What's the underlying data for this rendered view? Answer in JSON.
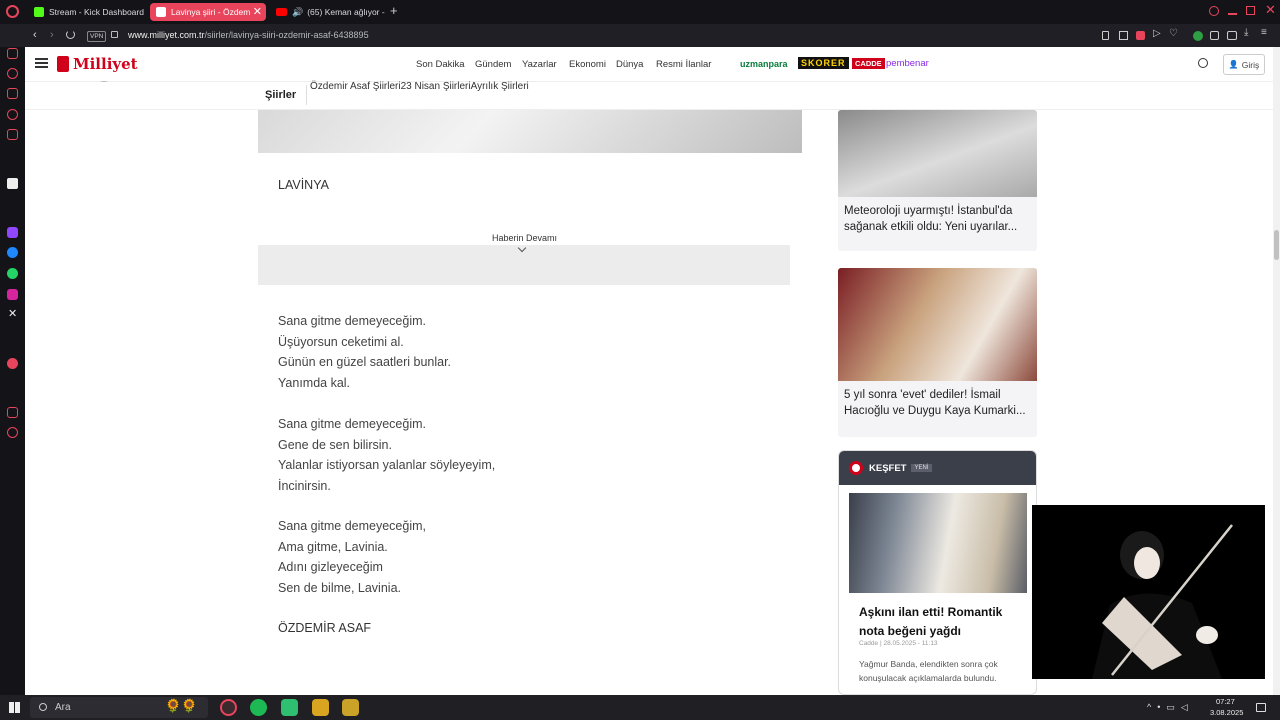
{
  "tabs": [
    {
      "label": "Stream - Kick Dashboard",
      "icon": "kick-icon"
    },
    {
      "label": "Lavinya şiiri - Özdem",
      "icon": "milliyet-favicon"
    },
    {
      "label": "(65) Keman ağlıyor - ",
      "icon": "youtube-icon"
    }
  ],
  "address": {
    "vpn": "VPN",
    "domain": "www.milliyet.com.tr",
    "path": "/siirler/lavinya-siiri-ozdemir-asaf-6438895"
  },
  "site": {
    "logo": "Milliyet",
    "nav": [
      "Son Dakika",
      "Gündem",
      "Yazarlar",
      "Ekonomi",
      "Dünya",
      "Resmi İlanlar"
    ],
    "partners": [
      "uzmanpara",
      "SKORER",
      "CADDE",
      "pembenar"
    ],
    "login": "Giriş"
  },
  "subhead": {
    "title": "Şiirler",
    "tags": "Özdemir Asaf Şiirleri23 Nisan ŞiirleriAyrılık Şiirleri"
  },
  "article": {
    "heading": "LAVİNYA",
    "continue": "Haberin Devamı",
    "stanzas": [
      [
        "Sana gitme demeyeceğim.",
        "Üşüyorsun ceketimi al.",
        "Günün en güzel saatleri bunlar.",
        "Yanımda kal."
      ],
      [
        "Sana gitme demeyeceğim.",
        "Gene de sen bilirsin.",
        "Yalanlar istiyorsan yalanlar söyleyeyim,",
        "İncinirsin."
      ],
      [
        "Sana gitme demeyeceğim,",
        "Ama gitme, Lavinia.",
        "Adını gizleyeceğim",
        "Sen de bilme, Lavinia."
      ]
    ],
    "author": "ÖZDEMİR ASAF"
  },
  "sidebar_cards": [
    {
      "title": "Meteoroloji uyarmıştı! İstanbul'da sağanak etkili oldu: Yeni uyarılar..."
    },
    {
      "title": "5 yıl sonra 'evet' dediler! İsmail Hacıoğlu ve Duygu Kaya Kumarki..."
    }
  ],
  "kesfet": {
    "label": "KEŞFET",
    "badge": "YENİ",
    "title": "Aşkını ilan etti! Romantik nota beğeni yağdı",
    "meta": "Cadde | 28.05.2025 - 11:13",
    "desc": "Yağmur Banda, elendikten sonra çok konuşulacak açıklamalarda bulundu."
  },
  "taskbar": {
    "search": "Ara",
    "time": "07:27",
    "date": "3.08.2025"
  },
  "colors": {
    "accent": "#e8455c",
    "milliyet_red": "#d0021b",
    "kesfet_bg": "#3b3f4a"
  }
}
